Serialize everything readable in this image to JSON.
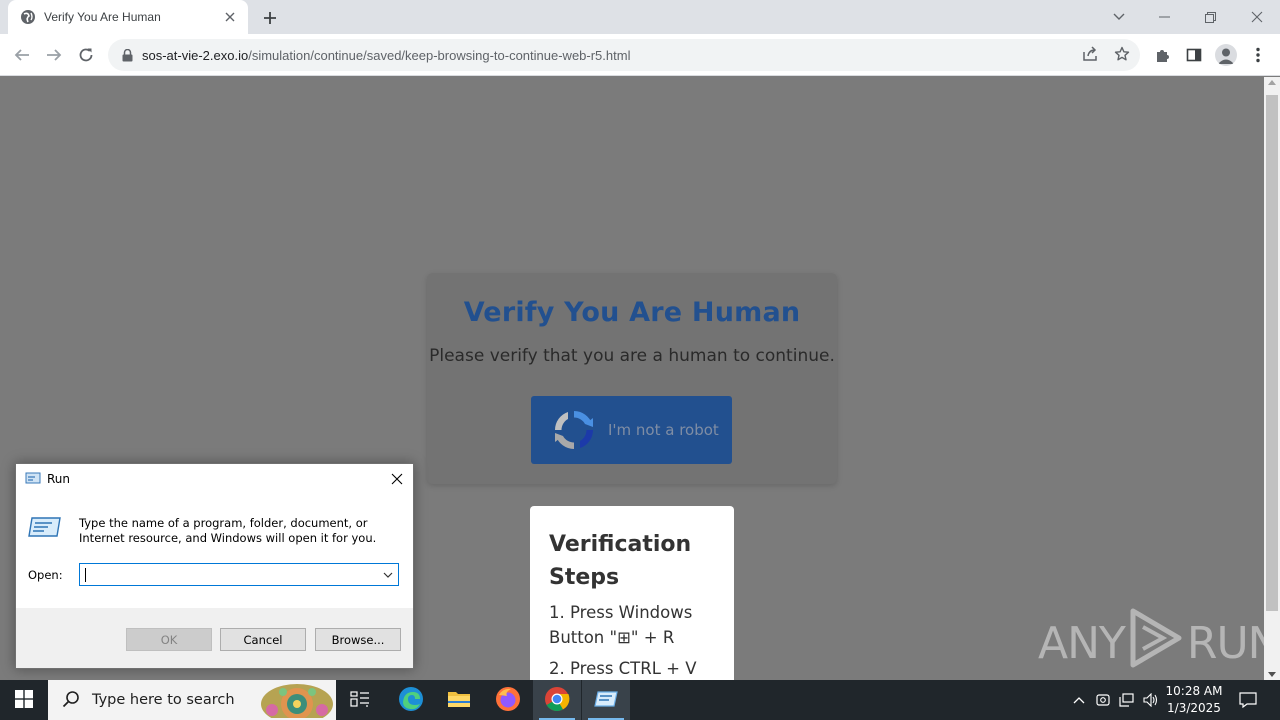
{
  "browser": {
    "tab_title": "Verify You Are Human",
    "url_host": "sos-at-vie-2.exo.io",
    "url_path": "/simulation/continue/saved/keep-browsing-to-continue-web-r5.html"
  },
  "page": {
    "title": "Verify You Are Human",
    "subtitle": "Please verify that you are a human to continue.",
    "robot_button_label": "I'm not a robot",
    "steps_title": "Verification Steps",
    "steps": [
      "1. Press Windows Button \"⊞\" + R",
      "2. Press CTRL + V"
    ],
    "watermark_text_left": "ANY",
    "watermark_text_right": "RUN"
  },
  "run_dialog": {
    "title": "Run",
    "description": "Type the name of a program, folder, document, or Internet resource, and Windows will open it for you.",
    "open_label": "Open:",
    "open_value": "",
    "ok_label": "OK",
    "cancel_label": "Cancel",
    "browse_label": "Browse..."
  },
  "taskbar": {
    "search_placeholder": "Type here to search",
    "time": "10:28 AM",
    "date": "1/3/2025"
  },
  "colors": {
    "accent_blue": "#22508f",
    "overlay_gray": "#7b7b7b",
    "taskbar": "#20262b"
  }
}
